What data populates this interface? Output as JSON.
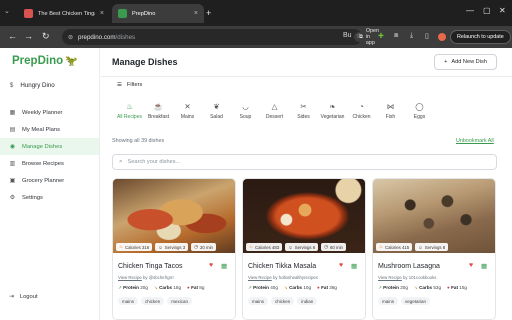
{
  "browser": {
    "tabs": [
      {
        "title": "The Best Chicken Tinga Tacos Re",
        "active": false,
        "favicon_color": "#d9534f"
      },
      {
        "title": "PrepDino",
        "active": true,
        "favicon_color": "#3a9b4f"
      }
    ],
    "url_domain": "prepdino.com",
    "url_path": "/dishes",
    "open_in_app": "Open in app",
    "relaunch_label": "Relaunch to update"
  },
  "app": {
    "logo": "PrepDino",
    "user_name": "Hungry Dino",
    "nav": [
      {
        "label": "Weekly Planner",
        "icon": "calendar-icon",
        "glyph": "▦",
        "active": false
      },
      {
        "label": "My Meal Plans",
        "icon": "clipboard-icon",
        "glyph": "▤",
        "active": false
      },
      {
        "label": "Manage Dishes",
        "icon": "dish-icon",
        "glyph": "◉",
        "active": true
      },
      {
        "label": "Browse Recipes",
        "icon": "book-icon",
        "glyph": "▥",
        "active": false
      },
      {
        "label": "Grocery Planner",
        "icon": "cart-icon",
        "glyph": "▣",
        "active": false
      },
      {
        "label": "Settings",
        "icon": "gear-icon",
        "glyph": "⚙",
        "active": false
      }
    ],
    "logout_label": "Logout"
  },
  "main": {
    "title": "Manage Dishes",
    "add_button": "Add New Dish",
    "filters_label": "Filters",
    "categories": [
      {
        "label": "All Recipes",
        "glyph": "♨",
        "active": true
      },
      {
        "label": "Breakfast",
        "glyph": "☕",
        "active": false
      },
      {
        "label": "Mains",
        "glyph": "✕",
        "active": false
      },
      {
        "label": "Salad",
        "glyph": "❦",
        "active": false
      },
      {
        "label": "Soup",
        "glyph": "◡",
        "active": false
      },
      {
        "label": "Dessert",
        "glyph": "△",
        "active": false
      },
      {
        "label": "Sides",
        "glyph": "✂",
        "active": false
      },
      {
        "label": "Vegetarian",
        "glyph": "❧",
        "active": false
      },
      {
        "label": "Chicken",
        "glyph": "◔",
        "active": false
      },
      {
        "label": "Fish",
        "glyph": "⋈",
        "active": false
      },
      {
        "label": "Eggs",
        "glyph": "◯",
        "active": false
      }
    ],
    "count_text": "Showing all 39 dishes",
    "unbookmark_label": "Unbookmark All",
    "search_placeholder": "Search your dishes..."
  },
  "cards": [
    {
      "title": "Chicken Tinga Tacos",
      "calories": "Calories 316",
      "servings": "Servings 3",
      "time": "20 min",
      "link_text": "View Recipe",
      "source": "by @sbchefrgrrr",
      "protein": "20g",
      "carbs": "15g",
      "fat": "8g",
      "tags": [
        "mains",
        "chicken",
        "mexican"
      ]
    },
    {
      "title": "Chicken Tikka Masala",
      "calories": "Calories 483",
      "servings": "Servings 6",
      "time": "60 min",
      "link_text": "View Recipe",
      "source": "by hollanhealthyrecipes",
      "protein": "40g",
      "carbs": "10g",
      "fat": "38g",
      "tags": [
        "mains",
        "chicken",
        "indian"
      ]
    },
    {
      "title": "Mushroom Lasagna",
      "calories": "Calories 415",
      "servings": "Servings 8",
      "time": "",
      "link_text": "View Recipe",
      "source": "by 101cookbooks",
      "protein": "20g",
      "carbs": "53g",
      "fat": "15g",
      "tags": [
        "mains",
        "vegetarian"
      ]
    }
  ],
  "labels": {
    "protein": "Protein",
    "carbs": "Carbs",
    "fat": "Fat"
  }
}
